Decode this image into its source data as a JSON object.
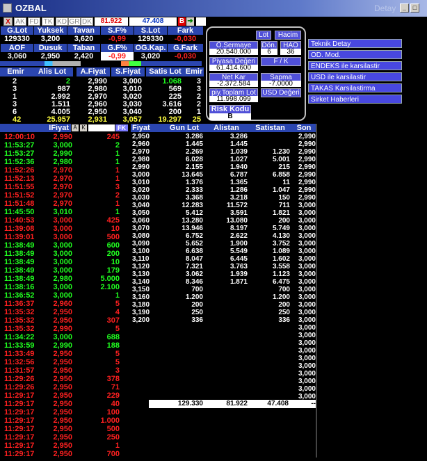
{
  "window": {
    "title": "OZBAL",
    "detail": "Detay"
  },
  "toolbar": {
    "close": "X",
    "tabs": [
      "AK",
      "FD",
      "TK",
      "KD",
      "GR",
      "DK"
    ],
    "last_price": "81.922",
    "volume": "47.408",
    "b_label": "B"
  },
  "summary": {
    "row1_headers": [
      "G.Lot",
      "Yuksek",
      "Tavan",
      "S.F%",
      "S.Lot",
      "Fark"
    ],
    "row1_values": [
      "129330",
      "3,200",
      "3,620",
      "-0,99",
      "129330",
      "-0,030"
    ],
    "row2_headers": [
      "AOF",
      "Dusuk",
      "Taban",
      "G.F%",
      "OG.Kap.",
      "G.Fark"
    ],
    "row2_values": [
      "3,060",
      "2,950",
      "2,420",
      "-0,99",
      "3,020",
      "-0,030"
    ]
  },
  "depth": {
    "headers": [
      "Emir",
      "Alis Lot",
      "A.Fiyat",
      "S.Fiyat",
      "Satis Lot",
      "Emir"
    ],
    "rows": [
      [
        "2",
        "2",
        "2,990",
        "3,000",
        "1.068",
        "3"
      ],
      [
        "3",
        "987",
        "2,980",
        "3,010",
        "569",
        "3"
      ],
      [
        "1",
        "2.992",
        "2,970",
        "3,020",
        "225",
        "2"
      ],
      [
        "3",
        "1.511",
        "2,960",
        "3,030",
        "3.616",
        "2"
      ],
      [
        "6",
        "4.005",
        "2,950",
        "3,040",
        "200",
        "1"
      ],
      [
        "42",
        "25.957",
        "2,931",
        "3,057",
        "19.297",
        "25"
      ]
    ]
  },
  "panel": {
    "lot": "Lot",
    "hacim": "Hacim",
    "o_sermaye_label": "Ö.Sermaye",
    "o_sermaye": "20.540.000",
    "don_label": "Dön.",
    "don": "6",
    "hao_label": "HAO",
    "hao": "36",
    "piyasa_label": "Piyasa Değeri",
    "piyasa": "61.414.600",
    "fk_label": "F / K",
    "fk": "",
    "net_kar_label": "Net Kar",
    "net_kar": "-2.372.584",
    "sapma_label": "Sapma",
    "sapma": "-7.0000",
    "toplam_lot_label": "piy.Toplam Lot",
    "toplam_lot": "11.998.099",
    "usd_label": "USD Değeri",
    "risk_label": "Risk Kodu",
    "risk": "B"
  },
  "side_menu": [
    "Teknik Detay",
    "OD. Mod.",
    "ENDEKS ile karsilastir",
    "USD ile karsilastir",
    "TAKAS Karsilastirma",
    "Sirket Haberleri"
  ],
  "trades": {
    "headers": {
      "time": "",
      "price": "IFiyat",
      "a": "A",
      "k": "K",
      "lot": "",
      "fk": "FK"
    },
    "rows": [
      [
        "12:00:10",
        "2,990",
        "245",
        "r"
      ],
      [
        "11:53:27",
        "3,000",
        "2",
        "g"
      ],
      [
        "11:53:27",
        "2,990",
        "1",
        "g"
      ],
      [
        "11:52:36",
        "2,980",
        "1",
        "g"
      ],
      [
        "11:52:26",
        "2,970",
        "1",
        "r"
      ],
      [
        "11:52:13",
        "2,970",
        "1",
        "r"
      ],
      [
        "11:51:55",
        "2,970",
        "3",
        "r"
      ],
      [
        "11:51:52",
        "2,970",
        "2",
        "r"
      ],
      [
        "11:51:48",
        "2,970",
        "1",
        "r"
      ],
      [
        "11:45:50",
        "3,010",
        "1",
        "g"
      ],
      [
        "11:40:53",
        "3,000",
        "425",
        "r"
      ],
      [
        "11:39:08",
        "3,000",
        "10",
        "r"
      ],
      [
        "11:39:01",
        "3,000",
        "500",
        "r"
      ],
      [
        "11:38:49",
        "3,000",
        "600",
        "g"
      ],
      [
        "11:38:49",
        "3,000",
        "200",
        "g"
      ],
      [
        "11:38:49",
        "3,000",
        "10",
        "g"
      ],
      [
        "11:38:49",
        "3,000",
        "179",
        "g"
      ],
      [
        "11:38:49",
        "2,980",
        "5.000",
        "g"
      ],
      [
        "11:38:16",
        "3,000",
        "2.100",
        "g"
      ],
      [
        "11:36:52",
        "3,000",
        "1",
        "g"
      ],
      [
        "11:36:37",
        "2,960",
        "5",
        "r"
      ],
      [
        "11:35:32",
        "2,950",
        "4",
        "r"
      ],
      [
        "11:35:32",
        "2,950",
        "307",
        "r"
      ],
      [
        "11:35:32",
        "2,990",
        "5",
        "r"
      ],
      [
        "11:34:22",
        "3,000",
        "688",
        "g"
      ],
      [
        "11:33:59",
        "2,990",
        "188",
        "g"
      ],
      [
        "11:33:49",
        "2,950",
        "5",
        "r"
      ],
      [
        "11:32:56",
        "2,950",
        "5",
        "r"
      ],
      [
        "11:31:57",
        "2,950",
        "3",
        "r"
      ],
      [
        "11:29:26",
        "2,950",
        "378",
        "r"
      ],
      [
        "11:29:26",
        "2,950",
        "71",
        "r"
      ],
      [
        "11:29:17",
        "2,950",
        "229",
        "r"
      ],
      [
        "11:29:17",
        "2,950",
        "40",
        "r"
      ],
      [
        "11:29:17",
        "2,950",
        "100",
        "r"
      ],
      [
        "11:29:17",
        "2,950",
        "1.000",
        "r"
      ],
      [
        "11:29:17",
        "2,950",
        "500",
        "r"
      ],
      [
        "11:29:17",
        "2,950",
        "250",
        "r"
      ],
      [
        "11:29:17",
        "2,950",
        "1",
        "r"
      ],
      [
        "11:29:17",
        "2,950",
        "700",
        "r"
      ]
    ]
  },
  "price_table": {
    "headers": [
      "Fiyat",
      "Gun Lot",
      "Alistan",
      "Satistan",
      "Son"
    ],
    "rows": [
      [
        "2,950",
        "3.286",
        "3.286",
        "",
        "2,990"
      ],
      [
        "2,960",
        "1.445",
        "1.445",
        "",
        "2,990"
      ],
      [
        "2,970",
        "2.269",
        "1.039",
        "1.230",
        "2,990"
      ],
      [
        "2,980",
        "6.028",
        "1.027",
        "5.001",
        "2,990"
      ],
      [
        "2,990",
        "2.155",
        "1.940",
        "215",
        "2,990"
      ],
      [
        "3,000",
        "13.645",
        "6.787",
        "6.858",
        "2,990"
      ],
      [
        "3,010",
        "1.376",
        "1.365",
        "11",
        "2,990"
      ],
      [
        "3,020",
        "2.333",
        "1.286",
        "1.047",
        "2,990"
      ],
      [
        "3,030",
        "3.368",
        "3.218",
        "150",
        "2,990"
      ],
      [
        "3,040",
        "12.283",
        "11.572",
        "711",
        "3,000"
      ],
      [
        "3,050",
        "5.412",
        "3.591",
        "1.821",
        "3,000"
      ],
      [
        "3,060",
        "13.280",
        "13.080",
        "200",
        "3,000"
      ],
      [
        "3,070",
        "13.946",
        "8.197",
        "5.749",
        "3,000"
      ],
      [
        "3,080",
        "6.752",
        "2.622",
        "4.130",
        "3,000"
      ],
      [
        "3,090",
        "5.652",
        "1.900",
        "3.752",
        "3,000"
      ],
      [
        "3,100",
        "6.638",
        "5.549",
        "1.089",
        "3,000"
      ],
      [
        "3,110",
        "8.047",
        "6.445",
        "1.602",
        "3,000"
      ],
      [
        "3,120",
        "7.321",
        "3.763",
        "3.558",
        "3,000"
      ],
      [
        "3,130",
        "3.062",
        "1.939",
        "1.123",
        "3,000"
      ],
      [
        "3,140",
        "8.346",
        "1.871",
        "6.475",
        "3,000"
      ],
      [
        "3,150",
        "700",
        "",
        "700",
        "3,000"
      ],
      [
        "3,160",
        "1.200",
        "",
        "1.200",
        "3,000"
      ],
      [
        "3,180",
        "200",
        "",
        "200",
        "3,000"
      ],
      [
        "3,190",
        "250",
        "",
        "250",
        "3,000"
      ],
      [
        "3,200",
        "336",
        "",
        "336",
        "3,000"
      ],
      [
        "",
        "",
        "",
        "",
        "3,000"
      ],
      [
        "",
        "",
        "",
        "",
        "3,000"
      ],
      [
        "",
        "",
        "",
        "",
        "3,000"
      ],
      [
        "",
        "",
        "",
        "",
        "3,000"
      ],
      [
        "",
        "",
        "",
        "",
        "3,000"
      ],
      [
        "",
        "",
        "",
        "",
        "3,000"
      ],
      [
        "",
        "",
        "",
        "",
        "3,000"
      ],
      [
        "",
        "",
        "",
        "",
        "3,000"
      ],
      [
        "",
        "",
        "",
        "",
        "3,000"
      ],
      [
        "",
        "",
        "",
        "",
        "3,000"
      ],
      [
        "",
        "",
        "",
        "",
        "3,000"
      ]
    ],
    "totals": [
      "129.330",
      "81.922",
      "47.408",
      "--"
    ]
  },
  "colors": {
    "red": "#ff2020",
    "green": "#20ff20",
    "yellow": "#ffff40",
    "blue": "#2b46b0",
    "cyan": "#40ffff",
    "panel_btn": "#5050d8"
  }
}
